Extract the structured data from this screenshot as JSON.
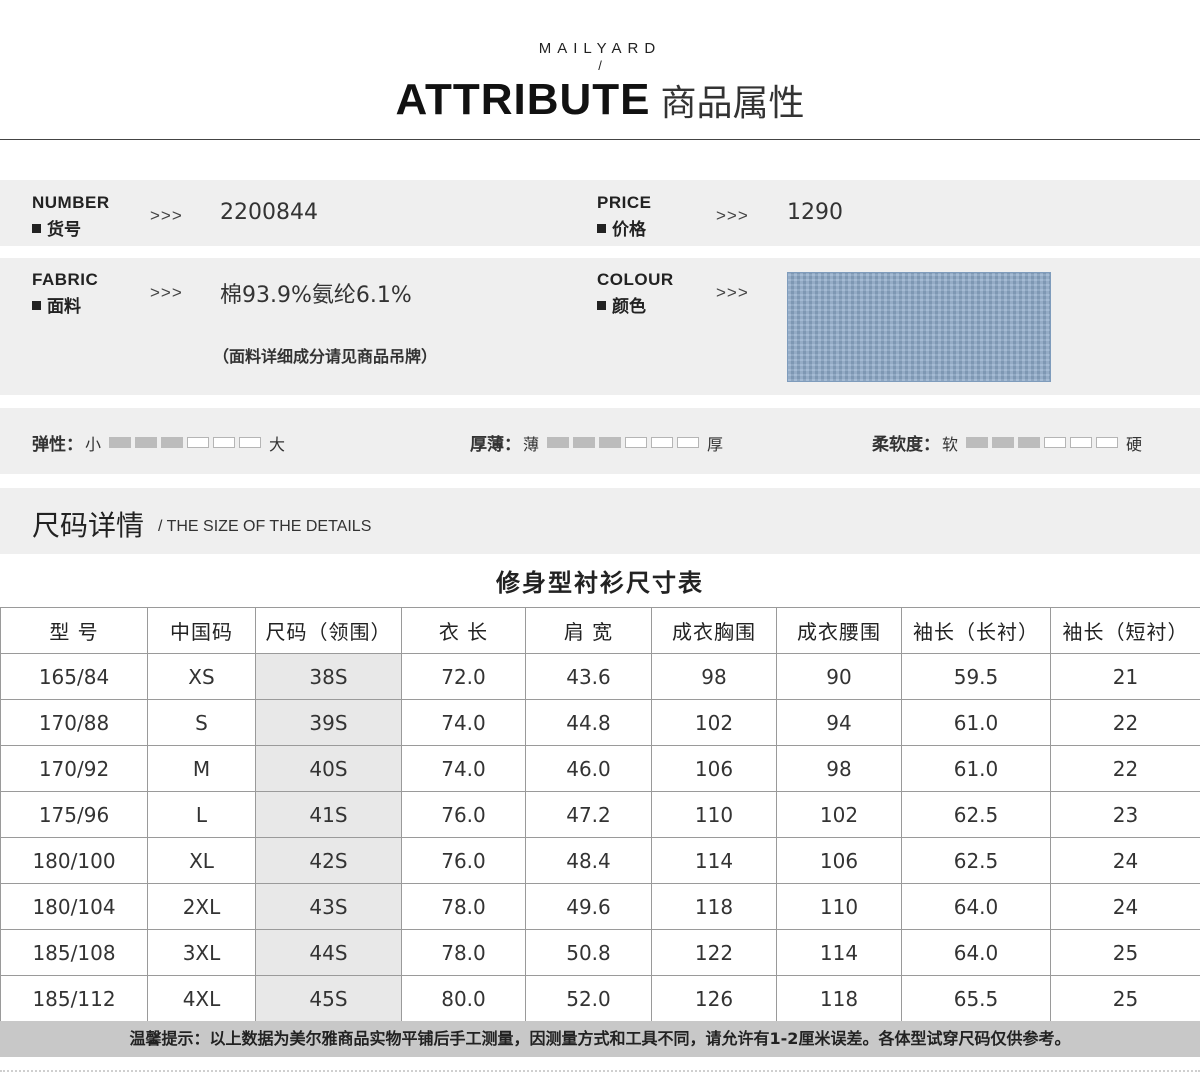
{
  "header": {
    "brand": "MAILYARD",
    "slash": "/",
    "title_en": "ATTRIBUTE",
    "title_cn": "商品属性"
  },
  "attributes": {
    "arrows": ">>>",
    "number": {
      "label_en": "NUMBER",
      "label_cn": "货号",
      "value": "2200844"
    },
    "price": {
      "label_en": "PRICE",
      "label_cn": "价格",
      "value": "1290"
    },
    "fabric": {
      "label_en": "FABRIC",
      "label_cn": "面料",
      "value": "棉93.9%氨纶6.1%",
      "note": "（面料详细成分请见商品吊牌）"
    },
    "colour": {
      "label_en": "COLOUR",
      "label_cn": "颜色",
      "swatch_color": "#8da9c8"
    }
  },
  "scales": {
    "elasticity": {
      "label": "弹性：",
      "min": "小",
      "max": "大",
      "filled": 3,
      "total": 6
    },
    "thickness": {
      "label": "厚薄：",
      "min": "薄",
      "max": "厚",
      "filled": 3,
      "total": 6
    },
    "softness": {
      "label": "柔软度：",
      "min": "软",
      "max": "硬",
      "filled": 3,
      "total": 6
    }
  },
  "size_section": {
    "title": "尺码详情",
    "subtitle": "/ THE SIZE OF THE DETAILS",
    "table_title": "修身型衬衫尺寸表"
  },
  "size_table": {
    "headers": [
      "型 号",
      "中国码",
      "尺码（领围）",
      "衣 长",
      "肩 宽",
      "成衣胸围",
      "成衣腰围",
      "袖长（长衬）",
      "袖长（短衬）"
    ],
    "rows": [
      [
        "165/84",
        "XS",
        "38S",
        "72.0",
        "43.6",
        "98",
        "90",
        "59.5",
        "21"
      ],
      [
        "170/88",
        "S",
        "39S",
        "74.0",
        "44.8",
        "102",
        "94",
        "61.0",
        "22"
      ],
      [
        "170/92",
        "M",
        "40S",
        "74.0",
        "46.0",
        "106",
        "98",
        "61.0",
        "22"
      ],
      [
        "175/96",
        "L",
        "41S",
        "76.0",
        "47.2",
        "110",
        "102",
        "62.5",
        "23"
      ],
      [
        "180/100",
        "XL",
        "42S",
        "76.0",
        "48.4",
        "114",
        "106",
        "62.5",
        "24"
      ],
      [
        "180/104",
        "2XL",
        "43S",
        "78.0",
        "49.6",
        "118",
        "110",
        "64.0",
        "24"
      ],
      [
        "185/108",
        "3XL",
        "44S",
        "78.0",
        "50.8",
        "122",
        "114",
        "64.0",
        "25"
      ],
      [
        "185/112",
        "4XL",
        "45S",
        "80.0",
        "52.0",
        "126",
        "118",
        "65.5",
        "25"
      ]
    ]
  },
  "footer": {
    "text": "温馨提示：以上数据为美尔雅商品实物平铺后手工测量，因测量方式和工具不同，请允许有1-2厘米误差。各体型试穿尺码仅供参考。"
  }
}
